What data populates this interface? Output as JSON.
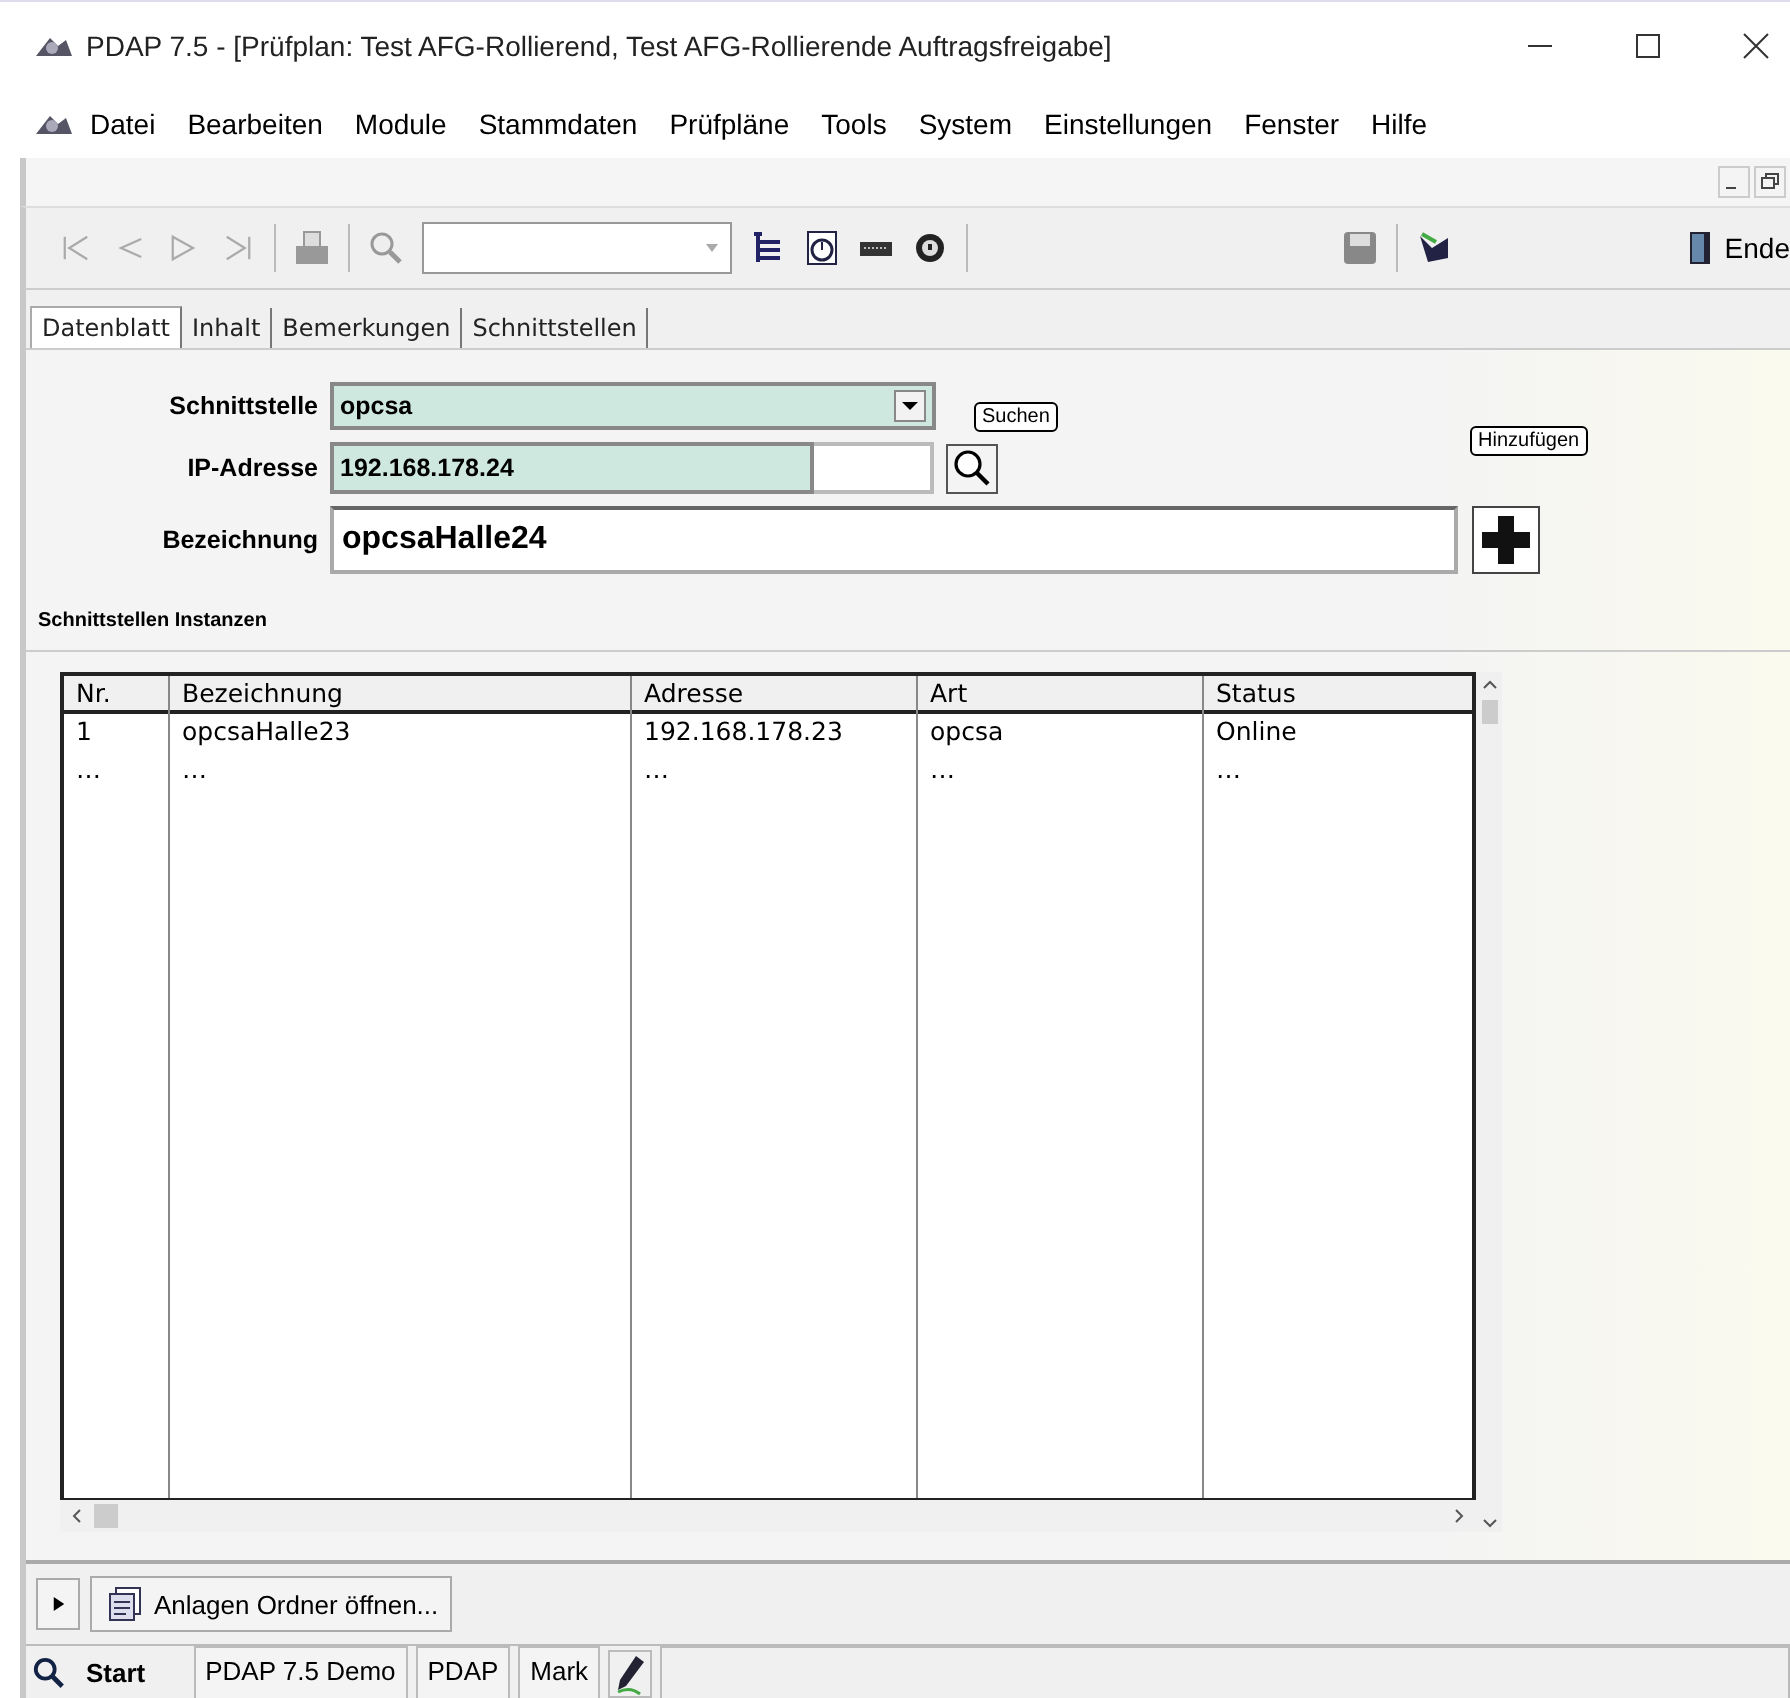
{
  "window": {
    "title": "PDAP 7.5 - [Prüfplan: Test AFG-Rollierend, Test AFG-Rollierende Auftragsfreigabe]"
  },
  "menu": [
    "Datei",
    "Bearbeiten",
    "Module",
    "Stammdaten",
    "Prüfpläne",
    "Tools",
    "System",
    "Einstellungen",
    "Fenster",
    "Hilfe"
  ],
  "toolbar": {
    "end_label": "Ende"
  },
  "tabs": [
    {
      "label": "Datenblatt",
      "selected": true
    },
    {
      "label": "Inhalt",
      "selected": false
    },
    {
      "label": "Bemerkungen",
      "selected": false
    },
    {
      "label": "Schnittstellen",
      "selected": false
    }
  ],
  "form": {
    "interface_label": "Schnittstelle",
    "interface_value": "opcsa",
    "ip_label": "IP-Adresse",
    "ip_value": "192.168.178.24",
    "search_tooltip": "Suchen",
    "name_label": "Bezeichnung",
    "name_value": "opcsaHalle24",
    "add_tooltip": "Hinzufügen"
  },
  "section_title": "Schnittstellen Instanzen",
  "table": {
    "columns": [
      "Nr.",
      "Bezeichnung",
      "Adresse",
      "Art",
      "Status"
    ],
    "rows": [
      [
        "1",
        "opcsaHalle23",
        "192.168.178.23",
        "opcsa",
        "Online"
      ],
      [
        "…",
        "…",
        "…",
        "…",
        "…"
      ]
    ]
  },
  "attachments_button": "Anlagen Ordner öffnen...",
  "status_bar": {
    "start": "Start",
    "items": [
      "PDAP 7.5 Demo",
      "PDAP",
      "Mark"
    ]
  }
}
